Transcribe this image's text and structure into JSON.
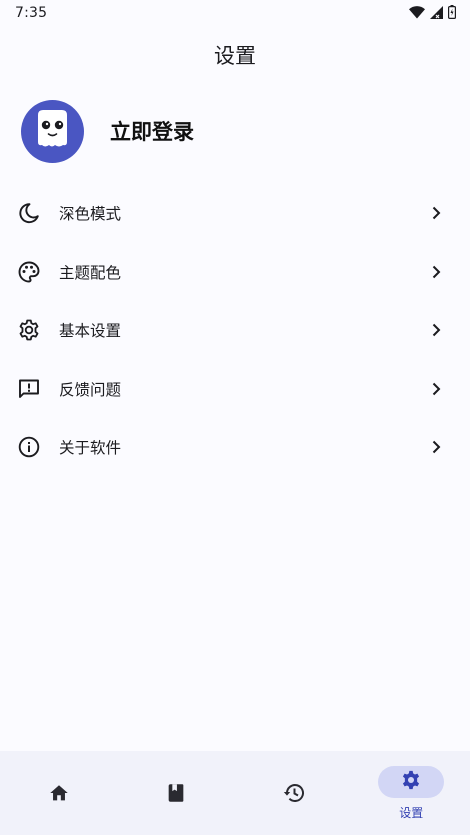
{
  "status_bar": {
    "time": "7:35",
    "icons": [
      "wifi-icon",
      "signal-icon",
      "battery-icon"
    ]
  },
  "app_bar": {
    "title": "设置"
  },
  "profile": {
    "name": "立即登录",
    "avatar_icon": "ghost-avatar-icon",
    "avatar_color": "#4a56c2"
  },
  "menu": {
    "items": [
      {
        "label": "深色模式",
        "icon": "moon-icon"
      },
      {
        "label": "主题配色",
        "icon": "palette-icon"
      },
      {
        "label": "基本设置",
        "icon": "gear-icon"
      },
      {
        "label": "反馈问题",
        "icon": "feedback-icon"
      },
      {
        "label": "关于软件",
        "icon": "info-icon"
      }
    ]
  },
  "bottom_nav": {
    "items": [
      {
        "icon": "home-icon",
        "label": ""
      },
      {
        "icon": "book-icon",
        "label": ""
      },
      {
        "icon": "history-icon",
        "label": ""
      },
      {
        "icon": "gear-icon",
        "label": "设置",
        "active": true
      }
    ],
    "accent": "#3341b2",
    "active_pill": "#d2d6f5"
  }
}
